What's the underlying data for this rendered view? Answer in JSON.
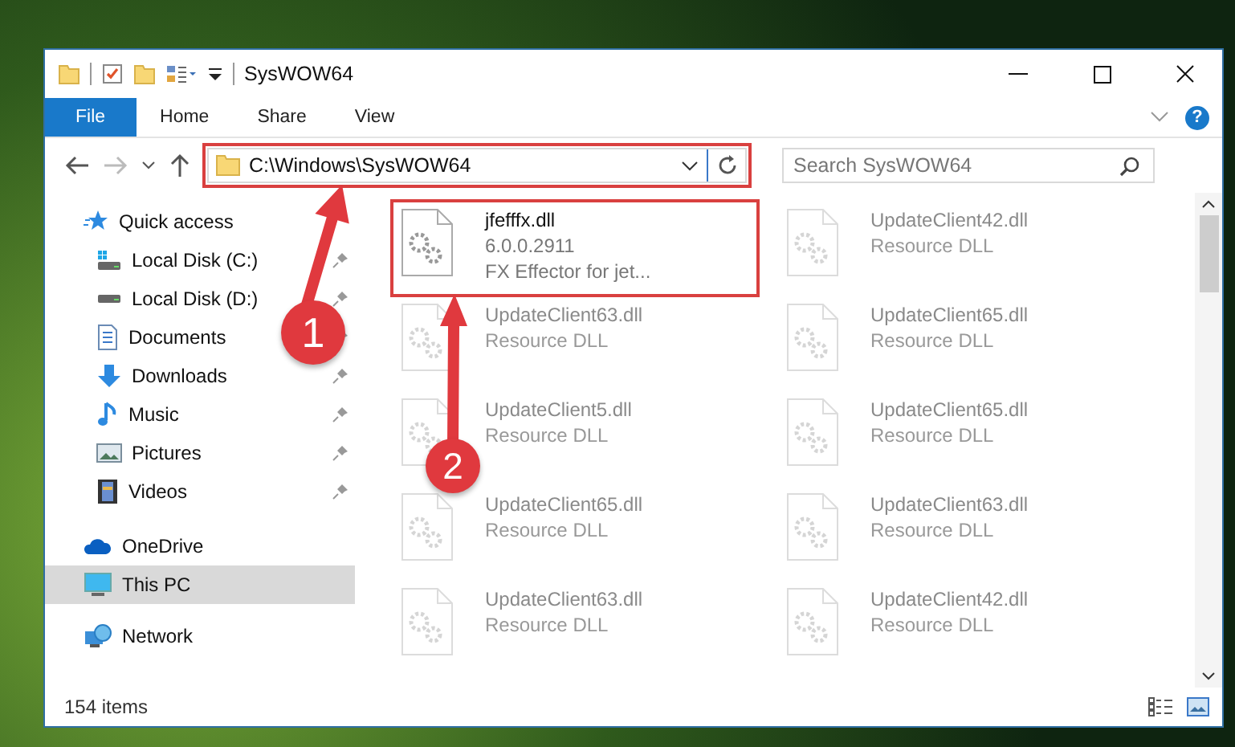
{
  "window": {
    "title": "SysWOW64"
  },
  "ribbon": {
    "tabs": [
      {
        "label": "File",
        "selected": true
      },
      {
        "label": "Home",
        "selected": false
      },
      {
        "label": "Share",
        "selected": false
      },
      {
        "label": "View",
        "selected": false
      }
    ],
    "help": "?"
  },
  "address_bar": {
    "path": "C:\\Windows\\SysWOW64",
    "highlighted": true
  },
  "search": {
    "placeholder": "Search SysWOW64"
  },
  "sidebar": {
    "items": [
      {
        "label": "Quick access",
        "selected": false,
        "children": [
          {
            "label": "Local Disk (C:)",
            "selected": false,
            "pinned": true
          },
          {
            "label": "Local Disk (D:)",
            "selected": false,
            "pinned": true
          },
          {
            "label": "Documents",
            "selected": false,
            "pinned": true
          },
          {
            "label": "Downloads",
            "selected": false,
            "pinned": true
          },
          {
            "label": "Music",
            "selected": false,
            "pinned": true
          },
          {
            "label": "Pictures",
            "selected": false,
            "pinned": true
          },
          {
            "label": "Videos",
            "selected": false,
            "pinned": true
          }
        ]
      },
      {
        "label": "OneDrive",
        "selected": false
      },
      {
        "label": "This PC",
        "selected": true
      },
      {
        "label": "Network",
        "selected": false
      }
    ]
  },
  "files": [
    {
      "lines": [
        "jfefffx.dll",
        "6.0.0.2911",
        "FX Effector for jet..."
      ],
      "highlighted": true,
      "dimmed": false
    },
    {
      "lines": [
        "UpdateClient42.dll",
        "Resource DLL"
      ],
      "highlighted": false,
      "dimmed": true
    },
    {
      "lines": [
        "UpdateClient63.dll",
        "Resource DLL"
      ],
      "highlighted": false,
      "dimmed": true
    },
    {
      "lines": [
        "UpdateClient65.dll",
        "Resource DLL"
      ],
      "highlighted": false,
      "dimmed": true
    },
    {
      "lines": [
        "UpdateClient5.dll",
        "Resource DLL"
      ],
      "highlighted": false,
      "dimmed": true
    },
    {
      "lines": [
        "UpdateClient65.dll",
        "Resource DLL"
      ],
      "highlighted": false,
      "dimmed": true
    },
    {
      "lines": [
        "UpdateClient65.dll",
        "Resource DLL"
      ],
      "highlighted": false,
      "dimmed": true
    },
    {
      "lines": [
        "UpdateClient63.dll",
        "Resource DLL"
      ],
      "highlighted": false,
      "dimmed": true
    },
    {
      "lines": [
        "UpdateClient63.dll",
        "Resource DLL"
      ],
      "highlighted": false,
      "dimmed": true
    },
    {
      "lines": [
        "UpdateClient42.dll",
        "Resource DLL"
      ],
      "highlighted": false,
      "dimmed": true
    }
  ],
  "status_bar": {
    "count": "154 items"
  },
  "annotations": [
    {
      "number": "1"
    },
    {
      "number": "2"
    }
  ]
}
